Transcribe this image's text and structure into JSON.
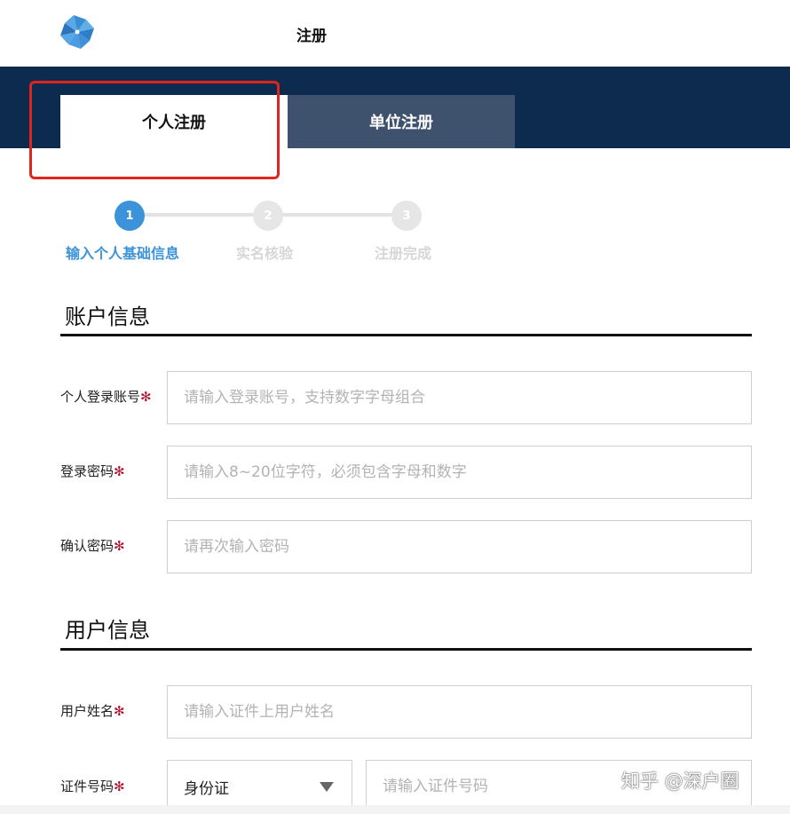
{
  "header": {
    "title": "注册"
  },
  "tabs": [
    {
      "label": "个人注册",
      "active": true
    },
    {
      "label": "单位注册",
      "active": false
    }
  ],
  "steps": [
    {
      "number": "1",
      "label": "输入个人基础信息",
      "active": true
    },
    {
      "number": "2",
      "label": "实名核验",
      "active": false
    },
    {
      "number": "3",
      "label": "注册完成",
      "active": false
    }
  ],
  "account_section": {
    "title": "账户信息",
    "fields": [
      {
        "label": "个人登录账号",
        "required_mark": "✻",
        "placeholder": "请输入登录账号，支持数字字母组合"
      },
      {
        "label": "登录密码",
        "required_mark": "✻",
        "placeholder": "请输入8~20位字符，必须包含字母和数字"
      },
      {
        "label": "确认密码",
        "required_mark": "✻",
        "placeholder": "请再次输入密码"
      }
    ]
  },
  "user_section": {
    "title": "用户信息",
    "name_field": {
      "label": "用户姓名",
      "required_mark": "✻",
      "placeholder": "请输入证件上用户姓名"
    },
    "id_field": {
      "label": "证件号码",
      "required_mark": "✻",
      "select_value": "身份证",
      "placeholder": "请输入证件号码"
    }
  },
  "watermark": "知乎 @深户圈",
  "colors": {
    "band": "#0c2b4e",
    "inactive_tab": "#3f526d",
    "step_active": "#3d93d9",
    "required": "#b3112c",
    "annotation": "#e0241e"
  }
}
